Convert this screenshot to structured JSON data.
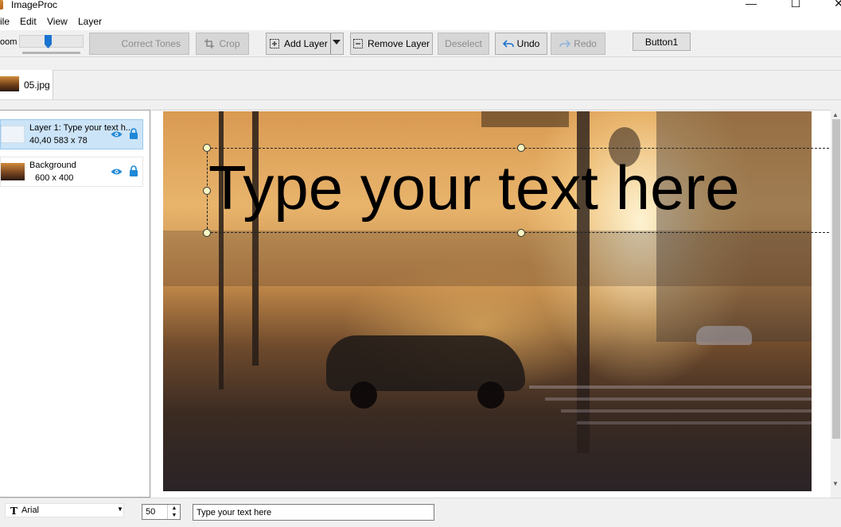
{
  "window": {
    "title": "ImageProc",
    "controls": {
      "minimize": "—",
      "maximize": "☐",
      "close": "✕"
    }
  },
  "menu": [
    "ile",
    "Edit",
    "View",
    "Layer"
  ],
  "toolbar": {
    "zoom_label": "oom",
    "correct_tones": "Correct Tones",
    "crop": "Crop",
    "add_layer": "Add Layer",
    "remove_layer": "Remove Layer",
    "deselect": "Deselect",
    "undo": "Undo",
    "redo": "Redo",
    "button1": "Button1"
  },
  "tabs": [
    {
      "label": "05.jpg"
    }
  ],
  "layers": [
    {
      "name": "Layer 1: Type your text h...",
      "info": "40,40  583 x 78",
      "selected": true
    },
    {
      "name": "Background",
      "info": "600 x 400",
      "selected": false
    }
  ],
  "canvas": {
    "text": "Type your text here"
  },
  "bottom": {
    "font": "Arial",
    "font_icon": "T",
    "size": "50",
    "text_value": "Type your text here"
  },
  "colors": {
    "accent": "#1a73d0",
    "selection": "#cce4f7",
    "eye_lock": "#1e88d6"
  }
}
